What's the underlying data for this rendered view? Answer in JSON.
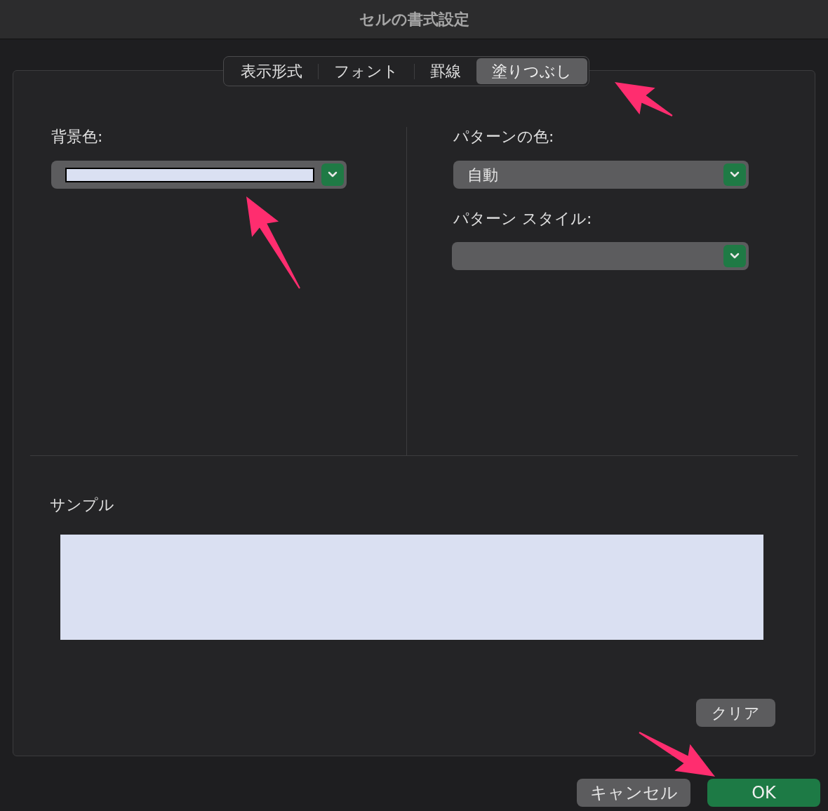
{
  "window": {
    "title": "セルの書式設定"
  },
  "tabs": [
    {
      "label": "表示形式",
      "selected": false
    },
    {
      "label": "フォント",
      "selected": false
    },
    {
      "label": "罫線",
      "selected": false
    },
    {
      "label": "塗りつぶし",
      "selected": true
    }
  ],
  "background_color": {
    "label": "背景色:",
    "color": "#dae0f2"
  },
  "pattern_color": {
    "label": "パターンの色:",
    "value": "自動"
  },
  "pattern_style": {
    "label": "パターン スタイル:"
  },
  "sample": {
    "label": "サンプル"
  },
  "clear_button": "クリア",
  "buttons": [
    {
      "label": "キャンセル",
      "kind": "secondary"
    },
    {
      "label": "OK",
      "kind": "primary"
    }
  ]
}
